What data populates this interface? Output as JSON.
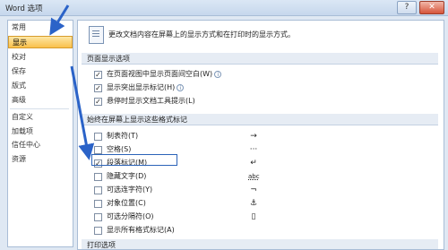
{
  "window": {
    "title": "Word 选项",
    "help_label": "?",
    "close_label": "✕"
  },
  "sidebar": {
    "items": [
      {
        "label": "常用"
      },
      {
        "label": "显示"
      },
      {
        "label": "校对"
      },
      {
        "label": "保存"
      },
      {
        "label": "版式"
      },
      {
        "label": "高级"
      },
      {
        "label": "自定义"
      },
      {
        "label": "加载项"
      },
      {
        "label": "信任中心"
      },
      {
        "label": "资源"
      }
    ],
    "selected_index": 1
  },
  "content": {
    "intro": "更改文档内容在屏幕上的显示方式和在打印时的显示方式。",
    "page_display": {
      "heading": "页面显示选项",
      "options": [
        {
          "label": "在页面视图中显示页面间空白(W)",
          "checked": true
        },
        {
          "label": "显示突出显示标记(H)",
          "checked": true
        },
        {
          "label": "悬停时显示文档工具提示(L)",
          "checked": true
        }
      ]
    },
    "marks": {
      "heading": "始终在屏幕上显示这些格式标记",
      "options": [
        {
          "label": "制表符(T)",
          "symbol": "→",
          "checked": false
        },
        {
          "label": "空格(S)",
          "symbol": "···",
          "checked": false
        },
        {
          "label": "段落标记(M)",
          "symbol": "↵",
          "checked": true
        },
        {
          "label": "隐藏文字(D)",
          "symbol": "abc",
          "checked": false
        },
        {
          "label": "可选连字符(Y)",
          "symbol": "¬",
          "checked": false
        },
        {
          "label": "对象位置(C)",
          "symbol": "⚓",
          "checked": false
        },
        {
          "label": "可选分隔符(O)",
          "symbol": "▯",
          "checked": false
        },
        {
          "label": "显示所有格式标记(A)",
          "symbol": "",
          "checked": false
        }
      ]
    },
    "print_heading": "打印选项"
  }
}
